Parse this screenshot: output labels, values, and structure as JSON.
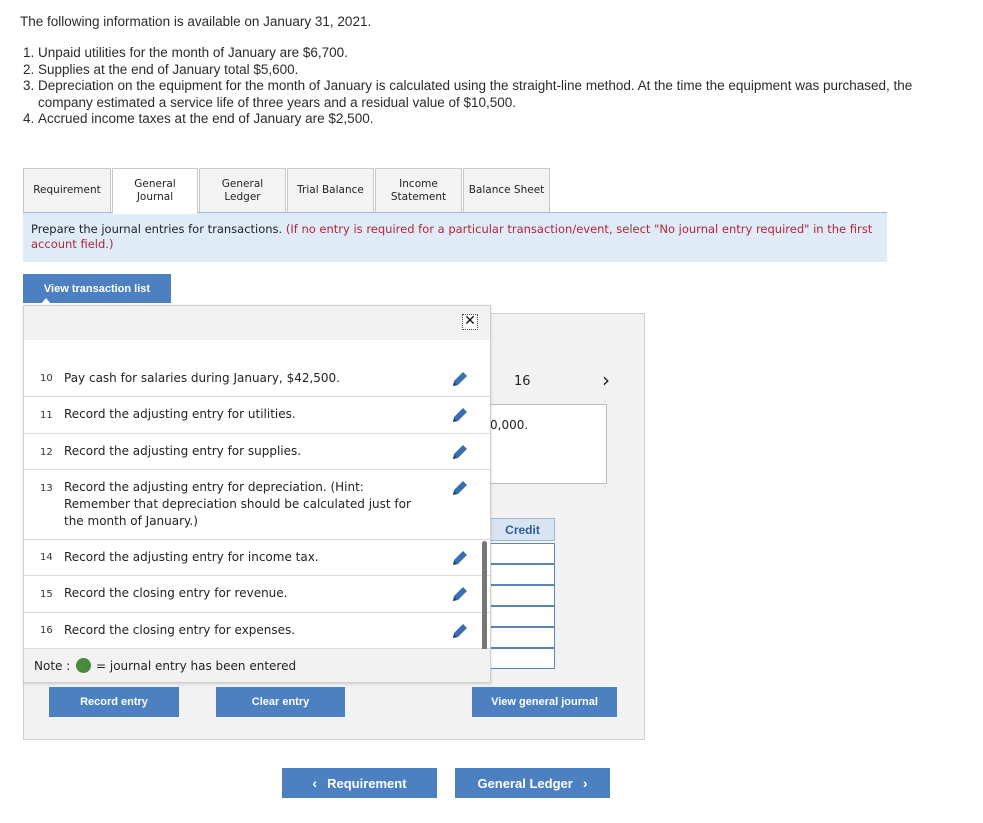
{
  "intro": {
    "heading": "The following information is available on January 31, 2021.",
    "items": [
      "Unpaid utilities for the month of January are $6,700.",
      "Supplies at the end of January total $5,600.",
      "Depreciation on the equipment for the month of January is calculated using the straight-line method. At the time the equipment was purchased, the company estimated a service life of three years and a residual value of $10,500.",
      "Accrued income taxes at the end of January are $2,500."
    ]
  },
  "tabs": [
    {
      "label": "Requirement"
    },
    {
      "label": "General Journal"
    },
    {
      "label": "General Ledger"
    },
    {
      "label": "Trial Balance"
    },
    {
      "label": "Income Statement"
    },
    {
      "label": "Balance Sheet"
    }
  ],
  "instructions": {
    "main": "Prepare the journal entries for transactions.",
    "hint": "(If no entry is required for a particular transaction/event, select \"No journal entry required\" in the first account field.)"
  },
  "view_transaction_button": "View transaction list",
  "workarea": {
    "page_number": "16",
    "description_partial": "0,000.",
    "credit_header": "Credit"
  },
  "transactions": [
    {
      "num": "10",
      "text": "Pay cash for salaries during January, $42,500."
    },
    {
      "num": "11",
      "text": "Record the adjusting entry for utilities."
    },
    {
      "num": "12",
      "text": "Record the adjusting entry for supplies."
    },
    {
      "num": "13",
      "text": "Record the adjusting entry for depreciation. (Hint: Remember that depreciation should be calculated just for the month of January.)"
    },
    {
      "num": "14",
      "text": "Record the adjusting entry for income tax."
    },
    {
      "num": "15",
      "text": "Record the closing entry for revenue."
    },
    {
      "num": "16",
      "text": "Record the closing entry for expenses."
    }
  ],
  "note": {
    "label": "Note :",
    "text": "= journal entry has been entered"
  },
  "buttons": {
    "record": "Record entry",
    "clear": "Clear entry",
    "view_journal": "View general journal",
    "prev": "Requirement",
    "next": "General Ledger"
  },
  "colors": {
    "button_blue": "#4d80c0",
    "instruction_bg": "#dfecf8",
    "hint_red": "#b5243a",
    "entered_green": "#4a8a3c"
  }
}
